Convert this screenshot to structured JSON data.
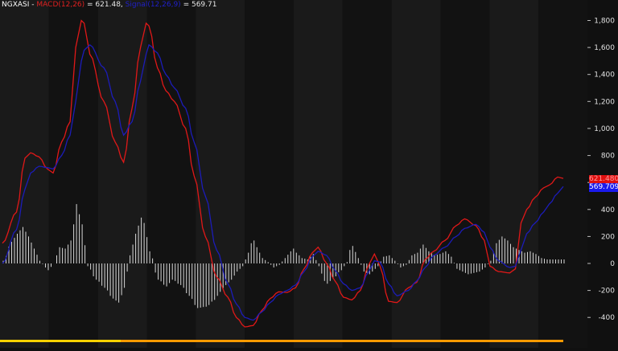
{
  "legend": {
    "symbol": "NGXASI",
    "macd_label": "MACD(12,26)",
    "macd_value": "= 621.48,",
    "signal_label": "Signal(12,26,9)",
    "signal_value": "= 569.71"
  },
  "tags": {
    "macd": "621.480",
    "signal": "569.709"
  },
  "colors": {
    "background": "#161616",
    "macd": "#e01818",
    "signal": "#1c1cb8",
    "histogram": "#d8d8d8",
    "axis_text": "#e0e0e0",
    "baseline": "#ff9a00"
  },
  "chart_data": {
    "type": "line",
    "title": "",
    "xlabel": "",
    "ylabel": "",
    "ylim": [
      -500,
      1950
    ],
    "yticks": [
      -400,
      -200,
      0,
      200,
      400,
      600,
      800,
      1000,
      1200,
      1400,
      1600,
      1800
    ],
    "ytick_labels": [
      "-400",
      "-200",
      "0",
      "200",
      "400",
      "600",
      "800",
      "1,000",
      "1,200",
      "1,400",
      "1,600",
      "1,800"
    ],
    "grid": false,
    "bands": 12,
    "x_count": 200,
    "series": [
      {
        "name": "MACD(12,26)",
        "kind": "line",
        "color": "#e01818",
        "keyframes": [
          [
            0,
            150
          ],
          [
            5,
            380
          ],
          [
            8,
            780
          ],
          [
            10,
            820
          ],
          [
            13,
            790
          ],
          [
            16,
            700
          ],
          [
            18,
            670
          ],
          [
            21,
            900
          ],
          [
            24,
            1050
          ],
          [
            26,
            1600
          ],
          [
            28,
            1800
          ],
          [
            29,
            1780
          ],
          [
            31,
            1550
          ],
          [
            36,
            1200
          ],
          [
            40,
            900
          ],
          [
            43,
            750
          ],
          [
            46,
            1150
          ],
          [
            49,
            1600
          ],
          [
            51,
            1780
          ],
          [
            52,
            1760
          ],
          [
            55,
            1450
          ],
          [
            58,
            1280
          ],
          [
            61,
            1200
          ],
          [
            65,
            1000
          ],
          [
            68,
            650
          ],
          [
            72,
            200
          ],
          [
            76,
            -100
          ],
          [
            80,
            -250
          ],
          [
            83,
            -400
          ],
          [
            86,
            -470
          ],
          [
            89,
            -460
          ],
          [
            92,
            -350
          ],
          [
            95,
            -260
          ],
          [
            98,
            -210
          ],
          [
            101,
            -215
          ],
          [
            104,
            -180
          ],
          [
            107,
            -40
          ],
          [
            110,
            80
          ],
          [
            112,
            120
          ],
          [
            115,
            0
          ],
          [
            118,
            -130
          ],
          [
            121,
            -250
          ],
          [
            124,
            -270
          ],
          [
            127,
            -200
          ],
          [
            130,
            -10
          ],
          [
            132,
            70
          ],
          [
            134,
            -20
          ],
          [
            137,
            -280
          ],
          [
            140,
            -290
          ],
          [
            144,
            -180
          ],
          [
            147,
            -140
          ],
          [
            150,
            30
          ],
          [
            153,
            90
          ],
          [
            157,
            170
          ],
          [
            161,
            280
          ],
          [
            164,
            330
          ],
          [
            168,
            280
          ],
          [
            171,
            170
          ],
          [
            173,
            -20
          ],
          [
            176,
            -60
          ],
          [
            180,
            -70
          ],
          [
            182,
            -40
          ],
          [
            184,
            300
          ],
          [
            186,
            400
          ],
          [
            189,
            490
          ],
          [
            192,
            560
          ],
          [
            194,
            580
          ],
          [
            197,
            640
          ],
          [
            199,
            630
          ]
        ]
      },
      {
        "name": "Signal(12,26,9)",
        "kind": "line",
        "color": "#1c1cb8",
        "keyframes": [
          [
            0,
            0
          ],
          [
            5,
            250
          ],
          [
            8,
            550
          ],
          [
            10,
            670
          ],
          [
            13,
            720
          ],
          [
            16,
            710
          ],
          [
            18,
            700
          ],
          [
            21,
            800
          ],
          [
            24,
            950
          ],
          [
            26,
            1200
          ],
          [
            28,
            1500
          ],
          [
            29,
            1580
          ],
          [
            31,
            1620
          ],
          [
            36,
            1450
          ],
          [
            40,
            1200
          ],
          [
            43,
            950
          ],
          [
            46,
            1050
          ],
          [
            49,
            1350
          ],
          [
            51,
            1550
          ],
          [
            52,
            1620
          ],
          [
            55,
            1560
          ],
          [
            58,
            1400
          ],
          [
            61,
            1300
          ],
          [
            65,
            1150
          ],
          [
            68,
            900
          ],
          [
            72,
            500
          ],
          [
            76,
            100
          ],
          [
            80,
            -150
          ],
          [
            83,
            -300
          ],
          [
            86,
            -400
          ],
          [
            89,
            -420
          ],
          [
            92,
            -360
          ],
          [
            95,
            -290
          ],
          [
            98,
            -230
          ],
          [
            101,
            -200
          ],
          [
            104,
            -160
          ],
          [
            107,
            -60
          ],
          [
            110,
            50
          ],
          [
            112,
            90
          ],
          [
            115,
            60
          ],
          [
            118,
            -50
          ],
          [
            121,
            -150
          ],
          [
            124,
            -200
          ],
          [
            127,
            -180
          ],
          [
            130,
            -60
          ],
          [
            132,
            20
          ],
          [
            134,
            10
          ],
          [
            137,
            -150
          ],
          [
            140,
            -240
          ],
          [
            144,
            -200
          ],
          [
            147,
            -130
          ],
          [
            150,
            -30
          ],
          [
            153,
            60
          ],
          [
            157,
            120
          ],
          [
            161,
            200
          ],
          [
            164,
            260
          ],
          [
            168,
            290
          ],
          [
            171,
            230
          ],
          [
            173,
            120
          ],
          [
            176,
            20
          ],
          [
            180,
            -30
          ],
          [
            182,
            -20
          ],
          [
            184,
            100
          ],
          [
            186,
            220
          ],
          [
            189,
            300
          ],
          [
            192,
            380
          ],
          [
            194,
            440
          ],
          [
            197,
            520
          ],
          [
            199,
            570
          ]
        ]
      },
      {
        "name": "Histogram",
        "kind": "bar",
        "color": "#d8d8d8",
        "keyframes": [
          [
            0,
            20
          ],
          [
            3,
            160
          ],
          [
            5,
            220
          ],
          [
            7,
            270
          ],
          [
            9,
            200
          ],
          [
            11,
            110
          ],
          [
            13,
            20
          ],
          [
            15,
            -30
          ],
          [
            16,
            -50
          ],
          [
            18,
            0
          ],
          [
            20,
            120
          ],
          [
            22,
            110
          ],
          [
            24,
            170
          ],
          [
            25,
            290
          ],
          [
            26,
            440
          ],
          [
            28,
            290
          ],
          [
            30,
            -20
          ],
          [
            33,
            -120
          ],
          [
            36,
            -180
          ],
          [
            39,
            -260
          ],
          [
            41,
            -290
          ],
          [
            43,
            -180
          ],
          [
            45,
            60
          ],
          [
            47,
            220
          ],
          [
            49,
            340
          ],
          [
            50,
            300
          ],
          [
            52,
            90
          ],
          [
            55,
            -120
          ],
          [
            58,
            -170
          ],
          [
            60,
            -120
          ],
          [
            63,
            -160
          ],
          [
            66,
            -240
          ],
          [
            69,
            -330
          ],
          [
            72,
            -320
          ],
          [
            75,
            -270
          ],
          [
            77,
            -210
          ],
          [
            79,
            -160
          ],
          [
            81,
            -120
          ],
          [
            83,
            -60
          ],
          [
            85,
            -20
          ],
          [
            87,
            80
          ],
          [
            88,
            150
          ],
          [
            89,
            170
          ],
          [
            90,
            120
          ],
          [
            92,
            40
          ],
          [
            94,
            10
          ],
          [
            96,
            -30
          ],
          [
            98,
            -10
          ],
          [
            100,
            40
          ],
          [
            102,
            90
          ],
          [
            103,
            110
          ],
          [
            104,
            80
          ],
          [
            106,
            40
          ],
          [
            108,
            30
          ],
          [
            110,
            70
          ],
          [
            112,
            -20
          ],
          [
            114,
            -130
          ],
          [
            115,
            -150
          ],
          [
            117,
            -110
          ],
          [
            120,
            -50
          ],
          [
            122,
            10
          ],
          [
            123,
            100
          ],
          [
            124,
            130
          ],
          [
            126,
            40
          ],
          [
            128,
            -60
          ],
          [
            130,
            -80
          ],
          [
            131,
            -60
          ],
          [
            133,
            -20
          ],
          [
            135,
            50
          ],
          [
            137,
            60
          ],
          [
            139,
            20
          ],
          [
            141,
            -30
          ],
          [
            143,
            -10
          ],
          [
            145,
            60
          ],
          [
            147,
            80
          ],
          [
            149,
            140
          ],
          [
            151,
            90
          ],
          [
            153,
            60
          ],
          [
            155,
            70
          ],
          [
            157,
            90
          ],
          [
            159,
            50
          ],
          [
            161,
            -40
          ],
          [
            163,
            -60
          ],
          [
            165,
            -80
          ],
          [
            167,
            -70
          ],
          [
            169,
            -60
          ],
          [
            171,
            -30
          ],
          [
            173,
            20
          ],
          [
            175,
            150
          ],
          [
            177,
            200
          ],
          [
            179,
            170
          ],
          [
            181,
            120
          ],
          [
            183,
            100
          ],
          [
            185,
            80
          ],
          [
            187,
            90
          ],
          [
            189,
            70
          ],
          [
            191,
            40
          ],
          [
            193,
            30
          ]
        ]
      }
    ]
  }
}
